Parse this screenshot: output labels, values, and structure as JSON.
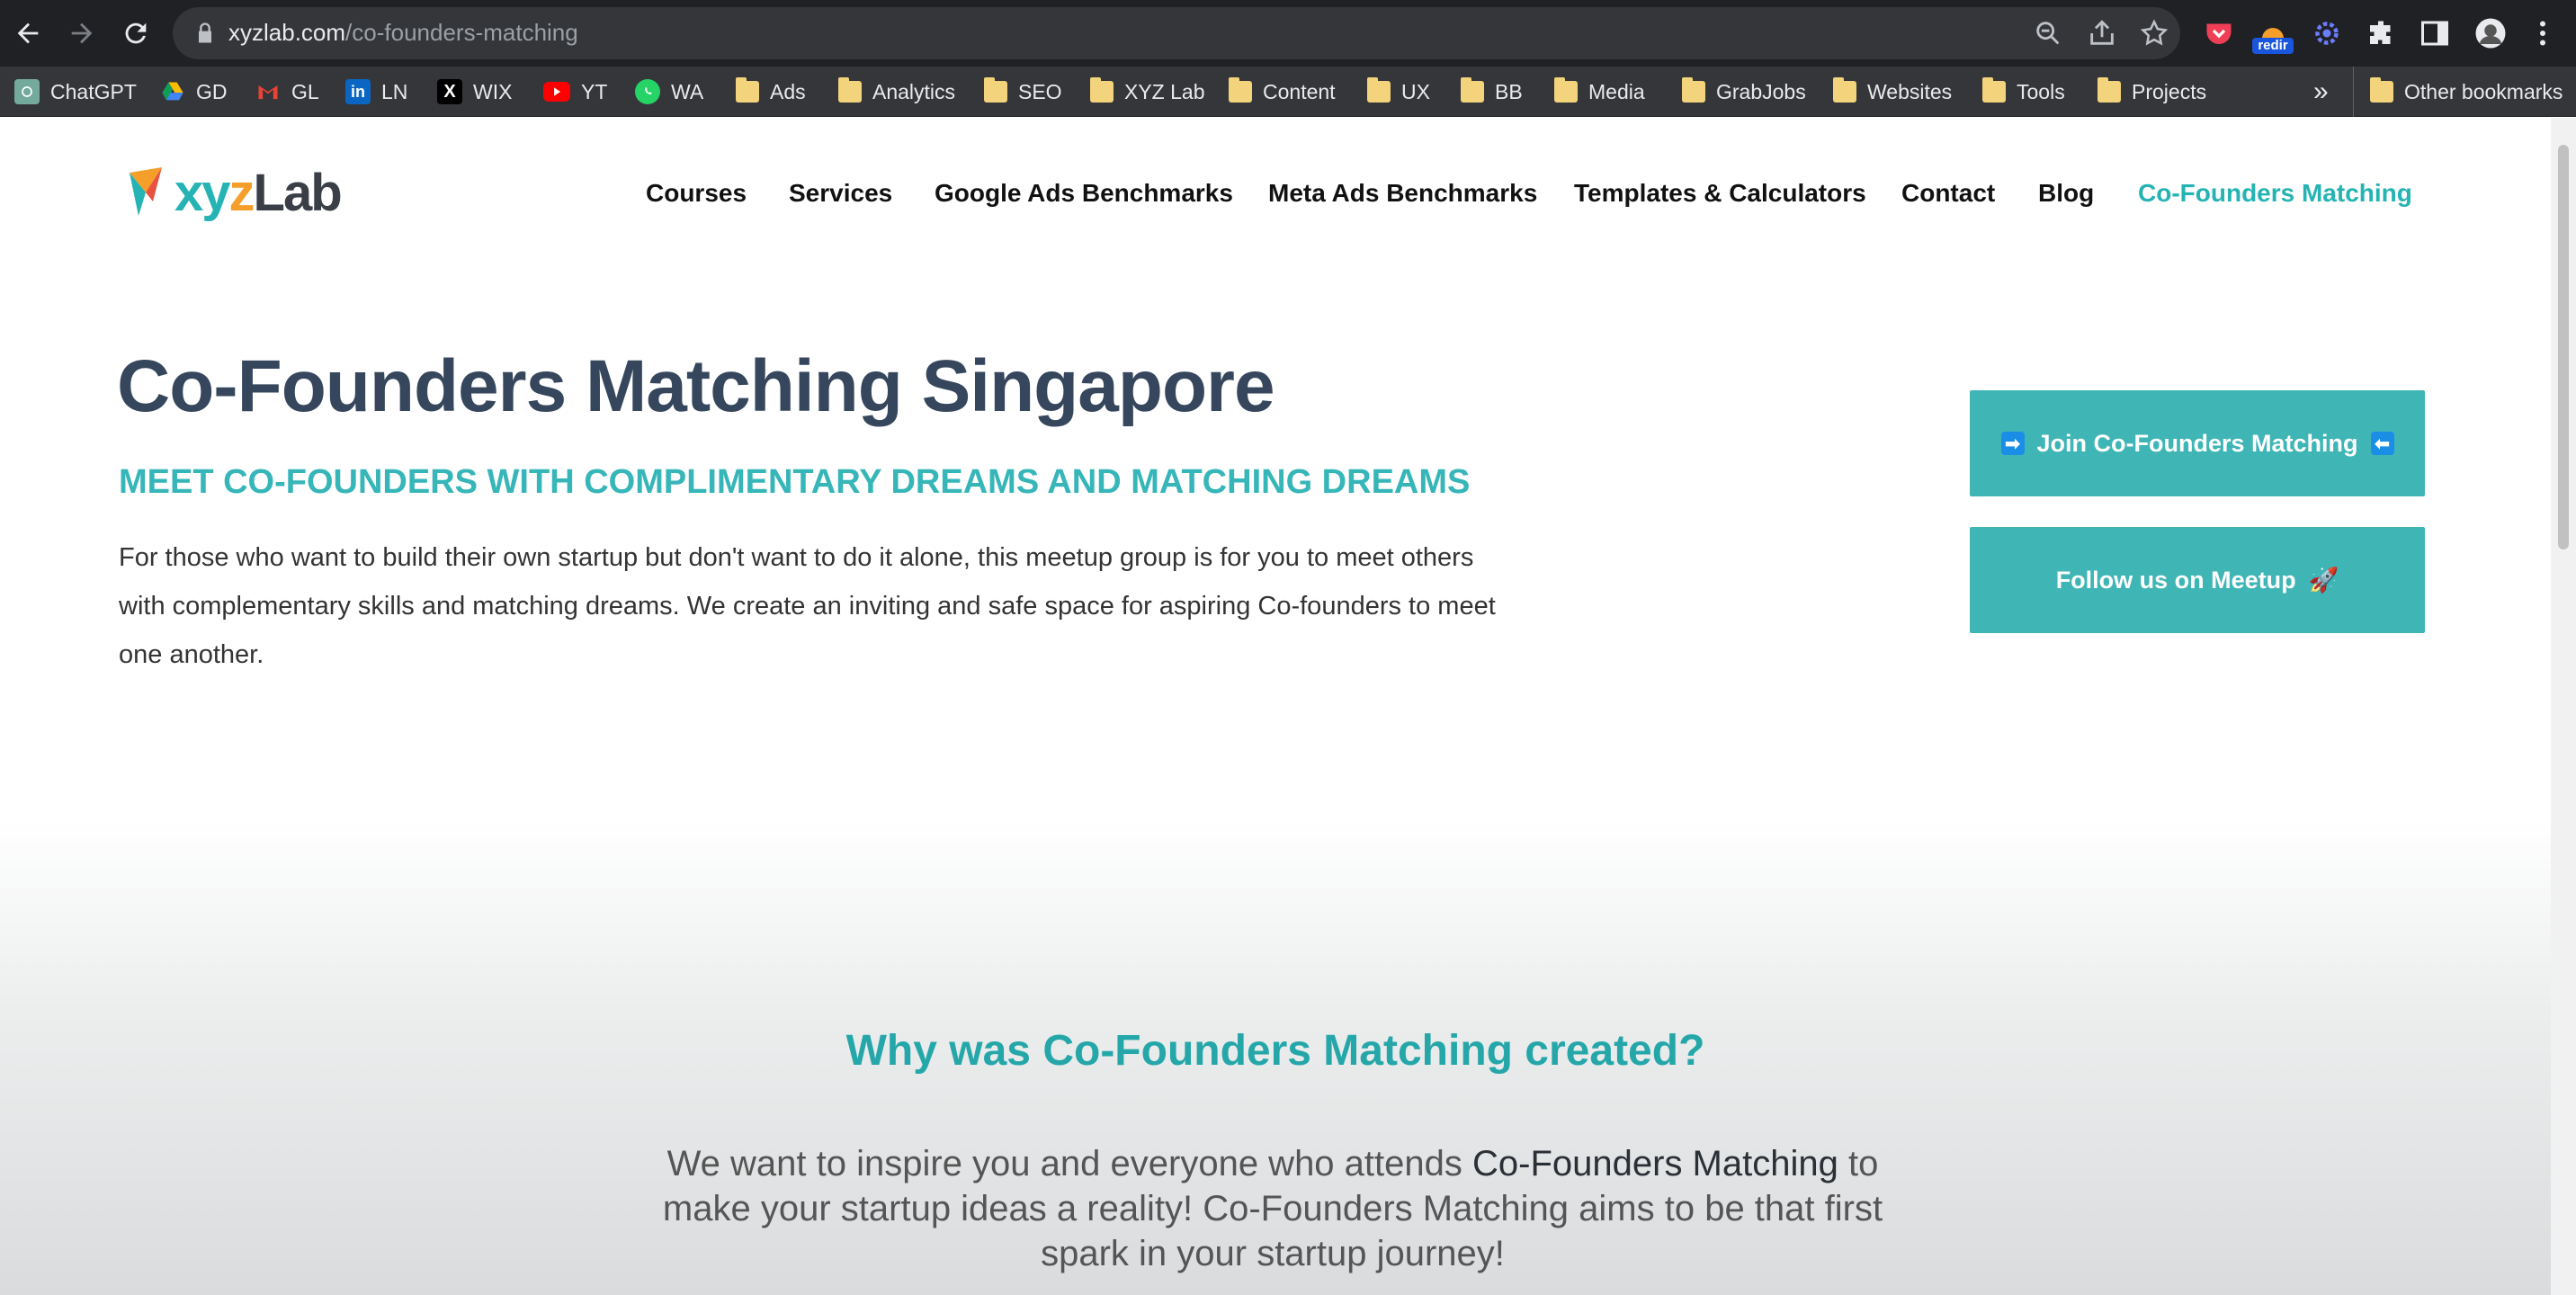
{
  "browser": {
    "url_domain": "xyzlab.com",
    "url_path": "/co-founders-matching",
    "extension_badge": "redir",
    "bookmarks": [
      {
        "label": "ChatGPT",
        "icon": "chatgpt-icon"
      },
      {
        "label": "GD",
        "icon": "google-drive-icon"
      },
      {
        "label": "GL",
        "icon": "gmail-icon"
      },
      {
        "label": "LN",
        "icon": "linkedin-icon"
      },
      {
        "label": "WIX",
        "icon": "x-icon"
      },
      {
        "label": "YT",
        "icon": "youtube-icon"
      },
      {
        "label": "WA",
        "icon": "whatsapp-icon"
      },
      {
        "label": "Ads",
        "icon": "folder-icon"
      },
      {
        "label": "Analytics",
        "icon": "folder-icon"
      },
      {
        "label": "SEO",
        "icon": "folder-icon"
      },
      {
        "label": "XYZ Lab",
        "icon": "folder-icon"
      },
      {
        "label": "Content",
        "icon": "folder-icon"
      },
      {
        "label": "UX",
        "icon": "folder-icon"
      },
      {
        "label": "BB",
        "icon": "folder-icon"
      },
      {
        "label": "Media",
        "icon": "folder-icon"
      },
      {
        "label": "GrabJobs",
        "icon": "folder-icon"
      },
      {
        "label": "Websites",
        "icon": "folder-icon"
      },
      {
        "label": "Tools",
        "icon": "folder-icon"
      },
      {
        "label": "Projects",
        "icon": "folder-icon"
      }
    ],
    "overflow_label": "»",
    "other_bookmarks": "Other bookmarks"
  },
  "site": {
    "logo": {
      "xy": "xy",
      "z": "z",
      "lab": "Lab"
    },
    "nav": [
      {
        "label": "Courses"
      },
      {
        "label": "Services"
      },
      {
        "label": "Google Ads Benchmarks"
      },
      {
        "label": "Meta Ads Benchmarks"
      },
      {
        "label": "Templates & Calculators"
      },
      {
        "label": "Contact"
      },
      {
        "label": "Blog"
      },
      {
        "label": "Co-Founders Matching",
        "active": true
      }
    ]
  },
  "hero": {
    "title": "Co-Founders Matching Singapore",
    "subtitle": "MEET CO-FOUNDERS WITH COMPLIMENTARY DREAMS AND MATCHING DREAMS",
    "body": "For those who want to build their own startup but don't want to do it alone, this meetup group is for you to meet others with complementary skills and matching dreams. We create an inviting and safe space for aspiring Co-founders to meet one another.",
    "cta_join": "Join Co-Founders Matching",
    "cta_join_left": "➡",
    "cta_join_right": "⬅",
    "cta_meetup": "Follow us on Meetup",
    "cta_meetup_emoji": "🚀"
  },
  "why": {
    "title": "Why was Co-Founders Matching created?",
    "text_before": "We want to inspire you and everyone who attends ",
    "text_em": "Co-Founders Matching",
    "text_after": " to make your startup ideas a reality! Co-Founders Matching aims to be that first spark in your startup journey!"
  },
  "colors": {
    "accent": "#3fb5b6",
    "heading": "#36475d",
    "chrome": "#202124"
  }
}
